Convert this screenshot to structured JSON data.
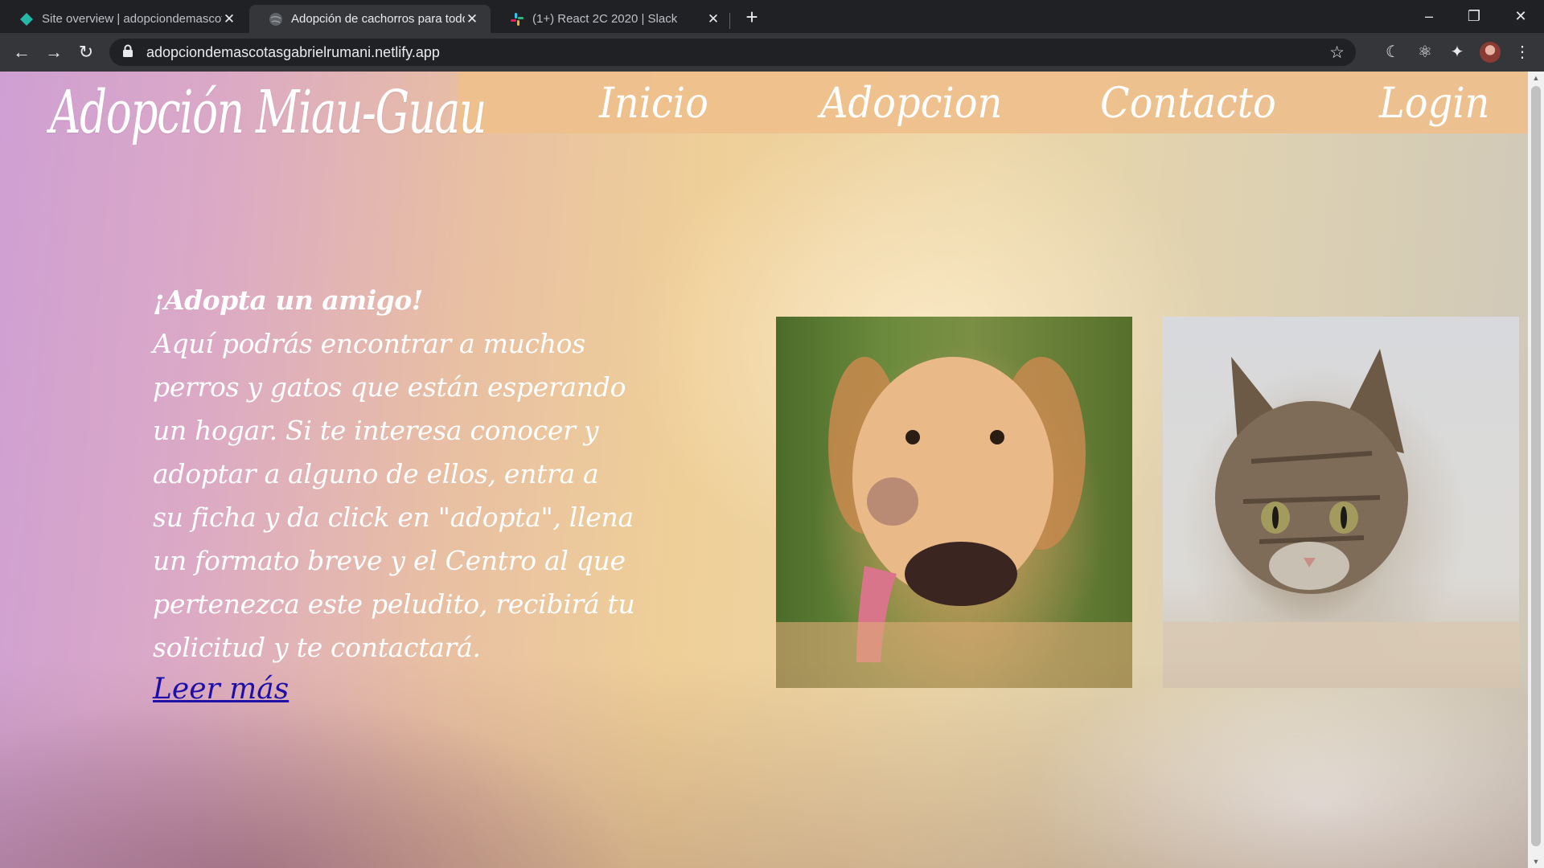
{
  "browser": {
    "tabs": [
      {
        "title": "Site overview | adopciondemascotasgabrielrumani",
        "active": false,
        "favicon": "netlify-icon"
      },
      {
        "title": "Adopción de cachorros para todos",
        "active": true,
        "favicon": "globe-icon"
      },
      {
        "title": "(1+) React 2C 2020 | Slack",
        "active": false,
        "favicon": "slack-icon"
      }
    ],
    "url": "adopciondemascotasgabrielrumani.netlify.app"
  },
  "site": {
    "logo": "Adopción Miau-Guau",
    "nav": [
      "Inicio",
      "Adopcion",
      "Contacto",
      "Login"
    ],
    "intro": {
      "title": "¡Adopta un amigo!",
      "body": "Aquí podrás encontrar a muchos perros y gatos que están esperando un hogar. Si te interesa conocer y adoptar a alguno de ellos, entra a su ficha y da click en \"adopta\", llena un formato breve y el Centro al que pertenezca este peludito, recibirá tu solicitud y te contactará.",
      "link": "Leer más"
    }
  },
  "colors": {
    "navbar": "#eec08c",
    "link": "#1a0dab",
    "chrome": "#202124"
  }
}
